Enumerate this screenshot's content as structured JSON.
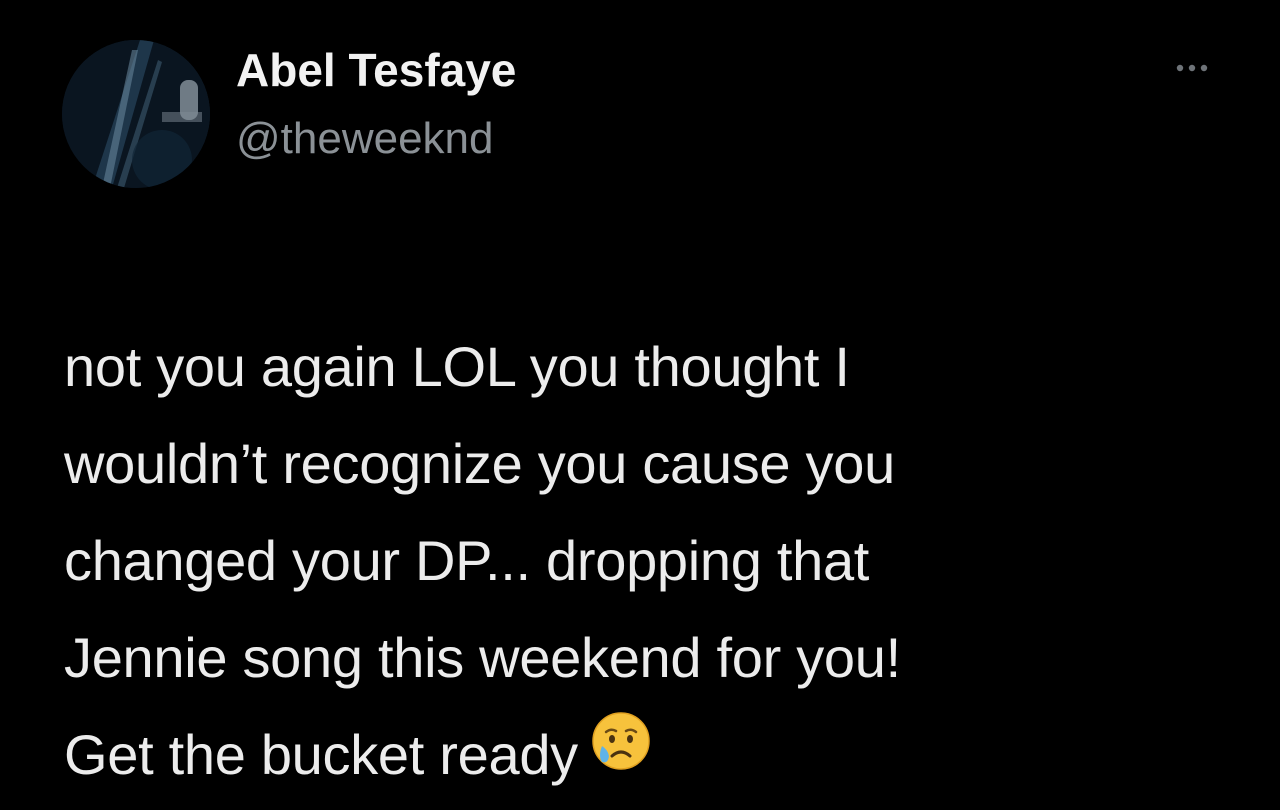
{
  "tweet": {
    "author": {
      "display_name": "Abel Tesfaye",
      "handle": "@theweeknd",
      "avatar_icon": "avatar-photo"
    },
    "more_icon": "ellipsis-icon",
    "text_lines": [
      "not you again LOL you thought I",
      "wouldn’t recognize you cause you",
      "changed your DP... dropping that",
      "Jennie song this weekend for you!",
      "Get the bucket ready"
    ],
    "emoji": "crying-face-emoji"
  },
  "colors": {
    "background": "#000000",
    "name": "#f2f2f2",
    "handle": "#8b9196",
    "text": "#ececec",
    "emoji_face": "#f7c23c",
    "emoji_tear": "#5fb3e8"
  }
}
